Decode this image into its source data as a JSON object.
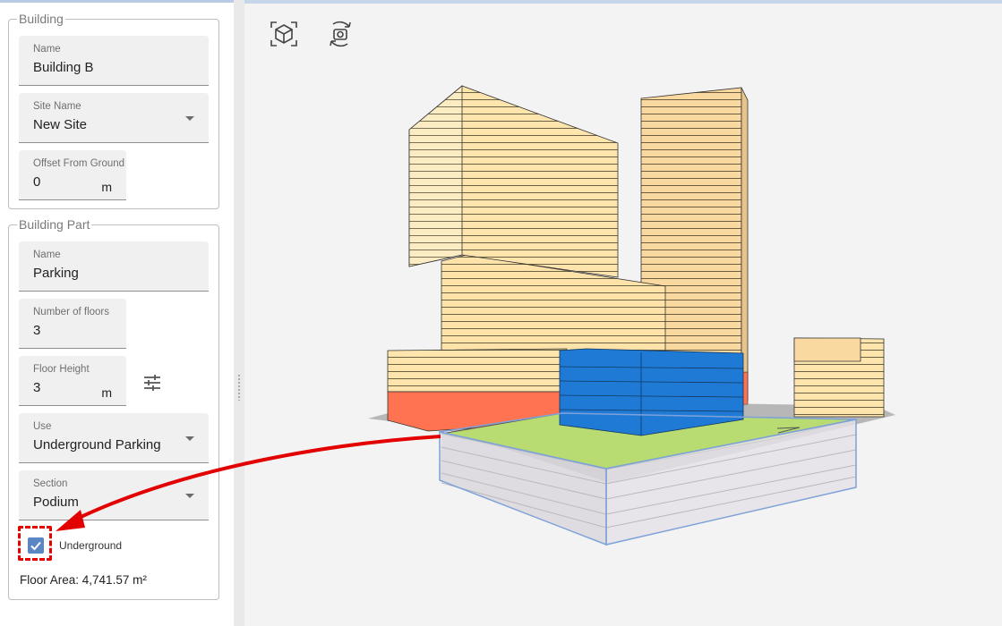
{
  "building": {
    "legend": "Building",
    "name": {
      "label": "Name",
      "value": "Building B"
    },
    "site": {
      "label": "Site Name",
      "value": "New Site"
    },
    "offset": {
      "label": "Offset From Ground",
      "value": "0",
      "unit": "m"
    }
  },
  "building_part": {
    "legend": "Building Part",
    "name": {
      "label": "Name",
      "value": "Parking"
    },
    "floors": {
      "label": "Number of floors",
      "value": "3"
    },
    "floor_height": {
      "label": "Floor Height",
      "value": "3",
      "unit": "m"
    },
    "use": {
      "label": "Use",
      "value": "Underground Parking"
    },
    "section": {
      "label": "Section",
      "value": "Podium"
    },
    "underground": {
      "label": "Underground",
      "checked": true
    },
    "floor_area": "Floor Area: 4,741.57 m²"
  },
  "viewport_tools": [
    {
      "name": "3d-view-icon"
    },
    {
      "name": "camera-reset-icon"
    }
  ],
  "colors": {
    "accent": "#5b86c4",
    "annotation": "#e20000",
    "selected_part": "#1f7ad6",
    "podium_fill": "#b8db72",
    "tower": "#fde5ad",
    "lower_floor": "#ff7351"
  }
}
